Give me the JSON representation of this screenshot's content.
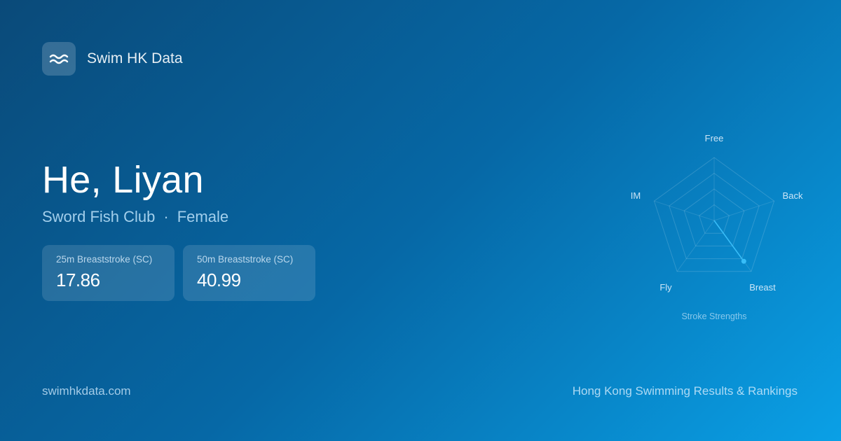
{
  "brand": {
    "name": "Swim HK Data",
    "logo_icon": "waves-icon"
  },
  "athlete": {
    "name": "He, Liyan",
    "club": "Sword Fish Club",
    "separator": "·",
    "gender": "Female"
  },
  "cards": [
    {
      "label": "25m Breaststroke (SC)",
      "value": "17.86"
    },
    {
      "label": "50m Breaststroke (SC)",
      "value": "40.99"
    }
  ],
  "radar": {
    "caption": "Stroke Strengths",
    "axes": [
      "Free",
      "Back",
      "Breast",
      "Fly",
      "IM"
    ],
    "values": [
      0,
      0,
      0.8,
      0,
      0
    ],
    "max": 1,
    "rings": 4,
    "accent_color": "#38bdf8"
  },
  "footer": {
    "site": "swimhkdata.com",
    "tagline": "Hong Kong Swimming Results & Rankings"
  }
}
